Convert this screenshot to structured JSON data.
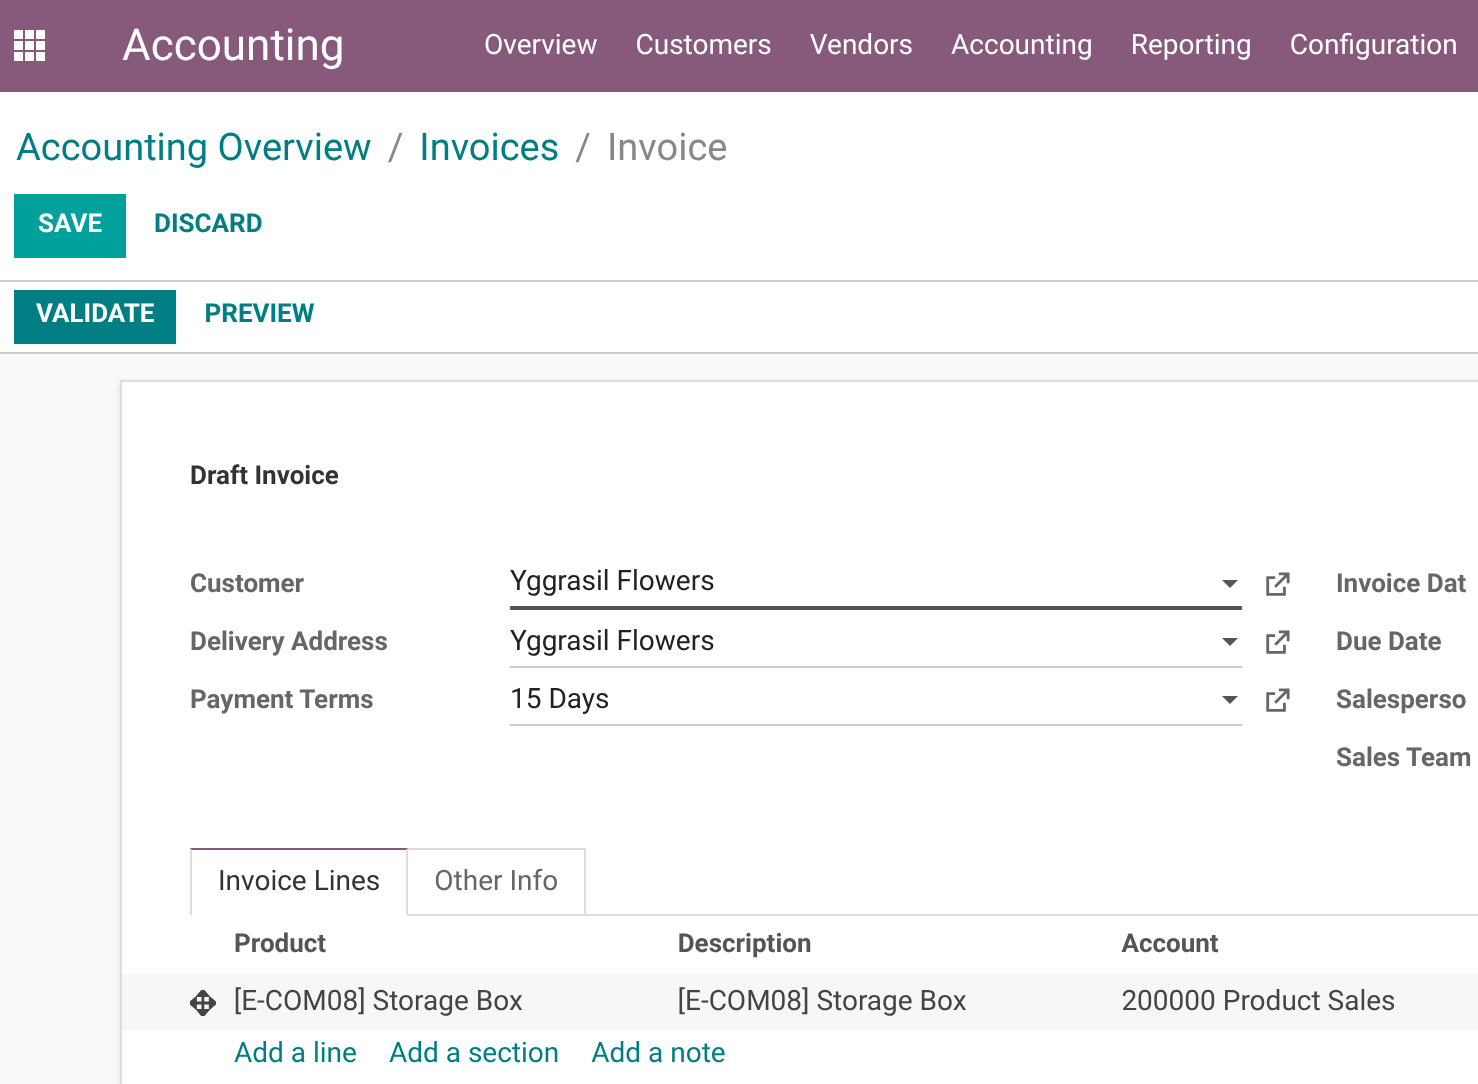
{
  "navbar": {
    "app_title": "Accounting",
    "menu": [
      "Overview",
      "Customers",
      "Vendors",
      "Accounting",
      "Reporting",
      "Configuration"
    ]
  },
  "breadcrumb": [
    {
      "label": "Accounting Overview",
      "link": true,
      "separator": "/"
    },
    {
      "label": "Invoices",
      "link": true,
      "separator": "/"
    },
    {
      "label": "Invoice",
      "link": false
    }
  ],
  "buttons": [
    {
      "label": "SAVE",
      "kind": "primary"
    },
    {
      "label": "DISCARD",
      "kind": "link"
    }
  ],
  "status_buttons": [
    {
      "label": "VALIDATE",
      "kind": "primary"
    },
    {
      "label": "PREVIEW",
      "kind": "link"
    }
  ],
  "form": {
    "title": "Draft Invoice",
    "fields": [
      {
        "label": "Customer",
        "value": "Yggrasil Flowers",
        "focused": true
      },
      {
        "label": "Delivery Address",
        "value": "Yggrasil Flowers",
        "focused": false
      },
      {
        "label": "Payment Terms",
        "value": "15 Days",
        "focused": false
      }
    ],
    "right_labels": [
      "Invoice Dat",
      "Due Date",
      "Salesperso",
      "Sales Team"
    ],
    "tabs": [
      {
        "label": "Invoice Lines",
        "selected": true
      },
      {
        "label": "Other Info",
        "selected": false
      }
    ],
    "table": {
      "columns": [
        "Product",
        "Description",
        "Account"
      ],
      "rows": [
        [
          "[E-COM08] Storage Box",
          "[E-COM08] Storage Box",
          "200000 Product Sales"
        ]
      ]
    },
    "add_links": [
      "Add a line",
      "Add a section",
      "Add a note"
    ]
  }
}
